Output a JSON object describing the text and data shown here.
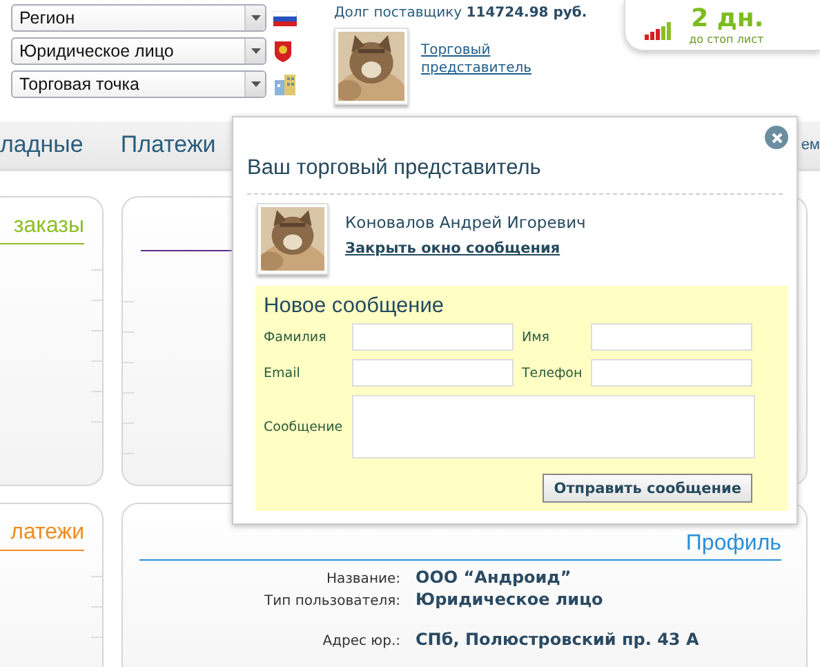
{
  "header": {
    "selects": [
      {
        "value": "Регион",
        "kind": "flag"
      },
      {
        "value": "Юридическое лицо",
        "kind": "emblem"
      },
      {
        "value": "Торговая точка",
        "kind": "building"
      }
    ],
    "debt": {
      "label": "Долг поставщику",
      "amount": "114724.98 руб."
    },
    "rep_link": "Торговый представитель",
    "stop_panel": {
      "days": "2 дн.",
      "caption": "до стоп лист"
    }
  },
  "nav": [
    "ладные",
    "Платежи",
    "ем"
  ],
  "cards": [
    {
      "title": "заказы",
      "color": "#8cbf26"
    },
    {
      "color": "#5a2d8c"
    },
    {
      "title": "латежи",
      "color": "#f08c1e"
    },
    {
      "title": "Профиль",
      "color": "#2b8fd6",
      "fields": [
        {
          "label": "Название:",
          "value": "ООО “Андроид”"
        },
        {
          "label": "Тип пользователя:",
          "value": "Юридическое лицо"
        },
        {
          "label": "Адрес юр.:",
          "value": "СПб, Полюстровский пр. 43 А"
        }
      ]
    }
  ],
  "modal": {
    "title": "Ваш торговый представитель",
    "rep_name": "Коновалов Андрей Игоревич",
    "close_link": "Закрыть окно сообщения",
    "form": {
      "title": "Новое сообщение",
      "fields": [
        {
          "label": "Фамилия",
          "kind": "text"
        },
        {
          "label": "Имя",
          "kind": "text"
        },
        {
          "label": "Email",
          "kind": "text"
        },
        {
          "label": "Телефон",
          "kind": "text"
        },
        {
          "label": "Сообщение",
          "kind": "textarea"
        }
      ],
      "button": "Отправить сообщение"
    }
  }
}
